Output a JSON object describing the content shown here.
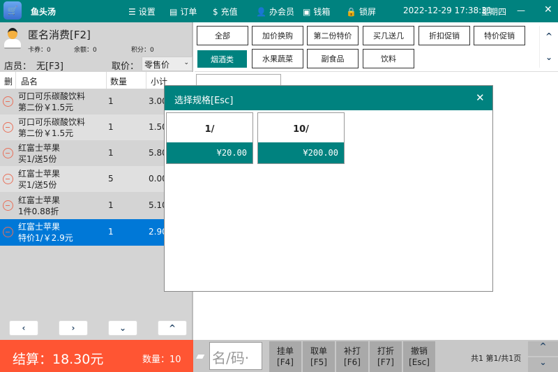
{
  "top": {
    "app": "鱼头汤",
    "menu": [
      "设置",
      "订单",
      "充值",
      "办会员",
      "钱箱",
      "锁屏"
    ],
    "datetime": "2022-12-29 17:38:31",
    "weekday": "星期四",
    "minimize": "—",
    "close": "✕"
  },
  "customer": {
    "name": "匿名消费[F2]",
    "coupon": "卡券：0",
    "balance": "余额：0",
    "points": "积分：0"
  },
  "staff": {
    "label": "店员：",
    "value": "无[F3]",
    "price_label": "取价：",
    "price_value": "零售价"
  },
  "table": {
    "headers": [
      "删",
      "品名",
      "数量",
      "小计"
    ],
    "rows": [
      {
        "name": "可口可乐碳酸饮料",
        "promo": "第二份￥1.5元",
        "qty": "1",
        "sub": "3.00"
      },
      {
        "name": "可口可乐碳酸饮料",
        "promo": "第二份￥1.5元",
        "qty": "1",
        "sub": "1.50"
      },
      {
        "name": "红富士苹果",
        "promo": "买1/送5份",
        "qty": "1",
        "sub": "5.80"
      },
      {
        "name": "红富士苹果",
        "promo": "买1/送5份",
        "qty": "5",
        "sub": "0.00"
      },
      {
        "name": "红富士苹果",
        "promo": "1件0.88折",
        "qty": "1",
        "sub": "5.10"
      },
      {
        "name": "红富士苹果",
        "promo": "特价1/￥2.9元",
        "qty": "1",
        "sub": "2.90"
      }
    ]
  },
  "categories": {
    "row1": [
      "全部",
      "加价换购",
      "第二份特价",
      "买几送几",
      "折扣促销",
      "特价促销"
    ],
    "row2": [
      "烟酒类",
      "水果蔬菜",
      "副食品",
      "饮料"
    ]
  },
  "modal": {
    "title": "选择规格[Esc]",
    "close": "✕",
    "specs": [
      {
        "name": "1/",
        "price": "¥20.00"
      },
      {
        "name": "10/",
        "price": "¥200.00"
      }
    ]
  },
  "bottom": {
    "total": "结算：18.30元",
    "qty": "数量：10",
    "search_placeholder": "名/码·",
    "buttons": [
      [
        "挂单",
        "[F4]"
      ],
      [
        "取单",
        "[F5]"
      ],
      [
        "补打",
        "[F6]"
      ],
      [
        "打折",
        "[F7]"
      ],
      [
        "撤销",
        "[Esc]"
      ]
    ],
    "pager": "共1 第1/共1页"
  },
  "colors": {
    "teal": "#00827f",
    "orange": "#ff5533",
    "selected": "#0078d7"
  }
}
